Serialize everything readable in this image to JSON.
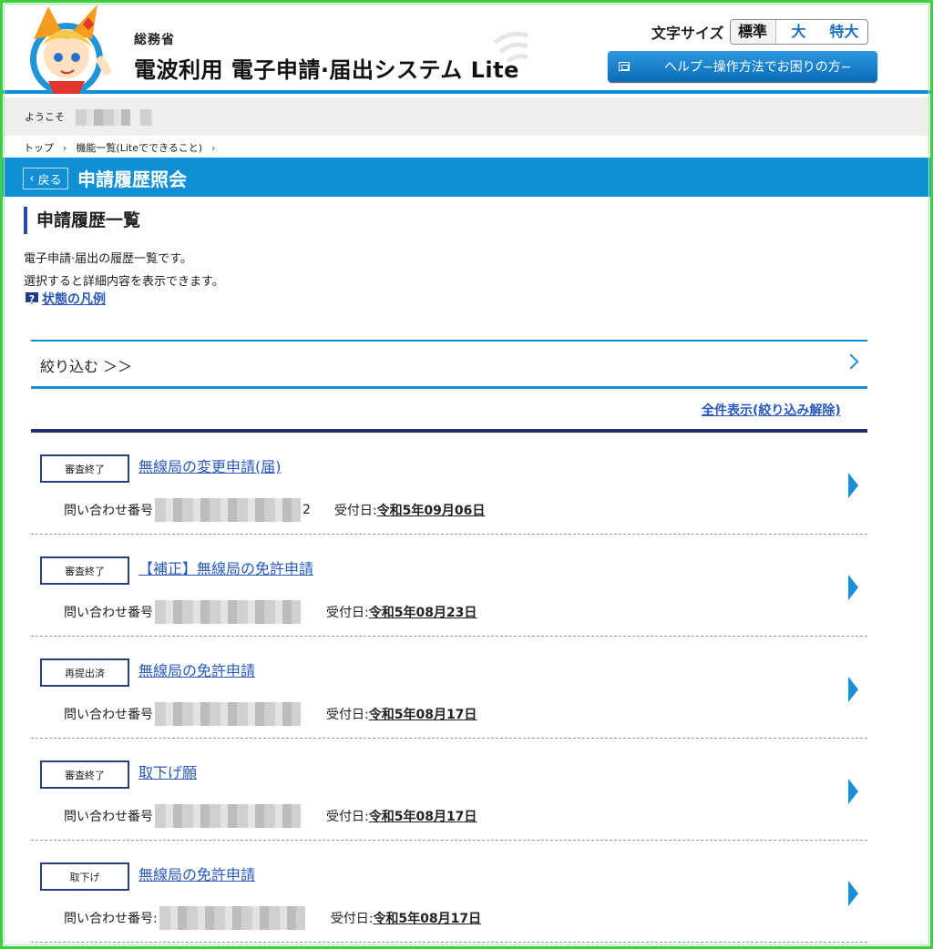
{
  "header": {
    "ministry": "総務省",
    "system_name": "電波利用 電子申請·届出システム Lite",
    "fontsize_label": "文字サイズ",
    "fontsize_options": [
      "標準",
      "大",
      "特大"
    ],
    "help_label": "ヘルプ−操作方法でお困りの方−"
  },
  "welcome": {
    "text": "ようこそ"
  },
  "breadcrumb": {
    "items": [
      "トップ",
      "機能一覧(Liteでできること)"
    ]
  },
  "titlebar": {
    "back_label": "戻る",
    "title": "申請履歴照会"
  },
  "section": {
    "heading": "申請履歴一覧",
    "desc1": "電子申請·届出の履歴一覧です。",
    "desc2": "選択すると詳細内容を表示できます。",
    "legend_link": "状態の凡例"
  },
  "filter": {
    "label": "絞り込む ＞＞",
    "show_all": "全件表示(絞り込み解除)"
  },
  "records": [
    {
      "status": "審査終了",
      "title": "無線局の変更申請(届)",
      "inquiry_label": "問い合わせ番号",
      "inquiry_suffix": "2",
      "received_label": "受付日:",
      "received_date": "令和5年09月06日"
    },
    {
      "status": "審査終了",
      "title": "【補正】無線局の免許申請",
      "inquiry_label": "問い合わせ番号",
      "inquiry_suffix": "",
      "received_label": "受付日:",
      "received_date": "令和5年08月23日"
    },
    {
      "status": "再提出済",
      "title": "無線局の免許申請",
      "inquiry_label": "問い合わせ番号",
      "inquiry_suffix": "",
      "received_label": "受付日:",
      "received_date": "令和5年08月17日"
    },
    {
      "status": "審査終了",
      "title": "取下げ願",
      "inquiry_label": "問い合わせ番号",
      "inquiry_suffix": "",
      "received_label": "受付日:",
      "received_date": "令和5年08月17日"
    },
    {
      "status": "取下げ",
      "title": "無線局の免許申請",
      "inquiry_label": "問い合わせ番号:",
      "inquiry_suffix": "",
      "received_label": "受付日:",
      "received_date": "令和5年08月17日"
    }
  ],
  "colors": {
    "accent": "#0e8fd6",
    "link": "#2a5ab8",
    "navy": "#1f2f6e",
    "frame": "#3dd13d"
  }
}
